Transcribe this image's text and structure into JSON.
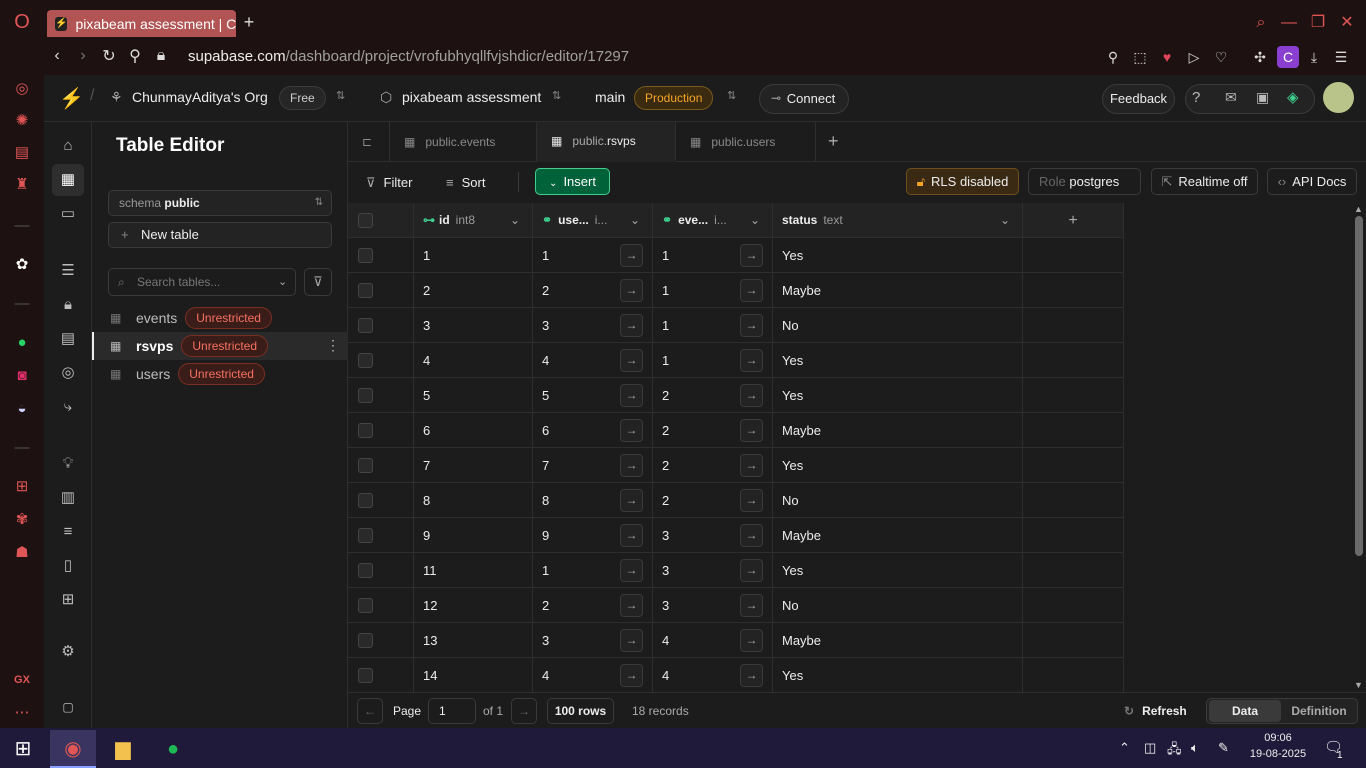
{
  "browser": {
    "tab_title": "pixabeam assessment | Cl",
    "new_tab": "+",
    "url_domain": "supabase.com",
    "url_path": "/dashboard/project/vrofubhyqllfvjshdicr/editor/17297",
    "profile_letter": "C"
  },
  "header": {
    "org_name": "ChunmayAditya's Org",
    "plan": "Free",
    "project_name": "pixabeam assessment",
    "branch": "main",
    "env": "Production",
    "connect": "Connect",
    "feedback": "Feedback"
  },
  "panel": {
    "title": "Table Editor",
    "schema_label": "schema",
    "schema_value": "public",
    "new_table": "New table",
    "search_placeholder": "Search tables...",
    "tables": [
      {
        "name": "events",
        "badge": "Unrestricted"
      },
      {
        "name": "rsvps",
        "badge": "Unrestricted"
      },
      {
        "name": "users",
        "badge": "Unrestricted"
      }
    ]
  },
  "tabs": [
    {
      "schema": "public.",
      "name": "events"
    },
    {
      "schema": "public.",
      "name": "rsvps"
    },
    {
      "schema": "public.",
      "name": "users"
    }
  ],
  "toolbar": {
    "filter": "Filter",
    "sort": "Sort",
    "insert": "Insert",
    "rls": "RLS disabled",
    "role_label": "Role",
    "role_value": "postgres",
    "realtime": "Realtime off",
    "api_docs": "API Docs"
  },
  "columns": [
    {
      "name": "id",
      "type": "int8"
    },
    {
      "name": "use...",
      "type": "i..."
    },
    {
      "name": "eve...",
      "type": "i..."
    },
    {
      "name": "status",
      "type": "text"
    }
  ],
  "rows": [
    {
      "id": "1",
      "user": "1",
      "event": "1",
      "status": "Yes"
    },
    {
      "id": "2",
      "user": "2",
      "event": "1",
      "status": "Maybe"
    },
    {
      "id": "3",
      "user": "3",
      "event": "1",
      "status": "No"
    },
    {
      "id": "4",
      "user": "4",
      "event": "1",
      "status": "Yes"
    },
    {
      "id": "5",
      "user": "5",
      "event": "2",
      "status": "Yes"
    },
    {
      "id": "6",
      "user": "6",
      "event": "2",
      "status": "Maybe"
    },
    {
      "id": "7",
      "user": "7",
      "event": "2",
      "status": "Yes"
    },
    {
      "id": "8",
      "user": "8",
      "event": "2",
      "status": "No"
    },
    {
      "id": "9",
      "user": "9",
      "event": "3",
      "status": "Maybe"
    },
    {
      "id": "11",
      "user": "1",
      "event": "3",
      "status": "Yes"
    },
    {
      "id": "12",
      "user": "2",
      "event": "3",
      "status": "No"
    },
    {
      "id": "13",
      "user": "3",
      "event": "4",
      "status": "Maybe"
    },
    {
      "id": "14",
      "user": "4",
      "event": "4",
      "status": "Yes"
    }
  ],
  "footer": {
    "page_label": "Page",
    "page_value": "1",
    "of_pages": "of 1",
    "rows_per_page": "100 rows",
    "records": "18 records",
    "refresh": "Refresh",
    "data_tab": "Data",
    "definition_tab": "Definition"
  },
  "taskbar": {
    "time": "09:06",
    "date": "19-08-2025",
    "notifications": "1"
  },
  "colors": {
    "accent_green": "#3ecf8e",
    "warning_badge": "#f87060",
    "production": "#f5a623"
  }
}
